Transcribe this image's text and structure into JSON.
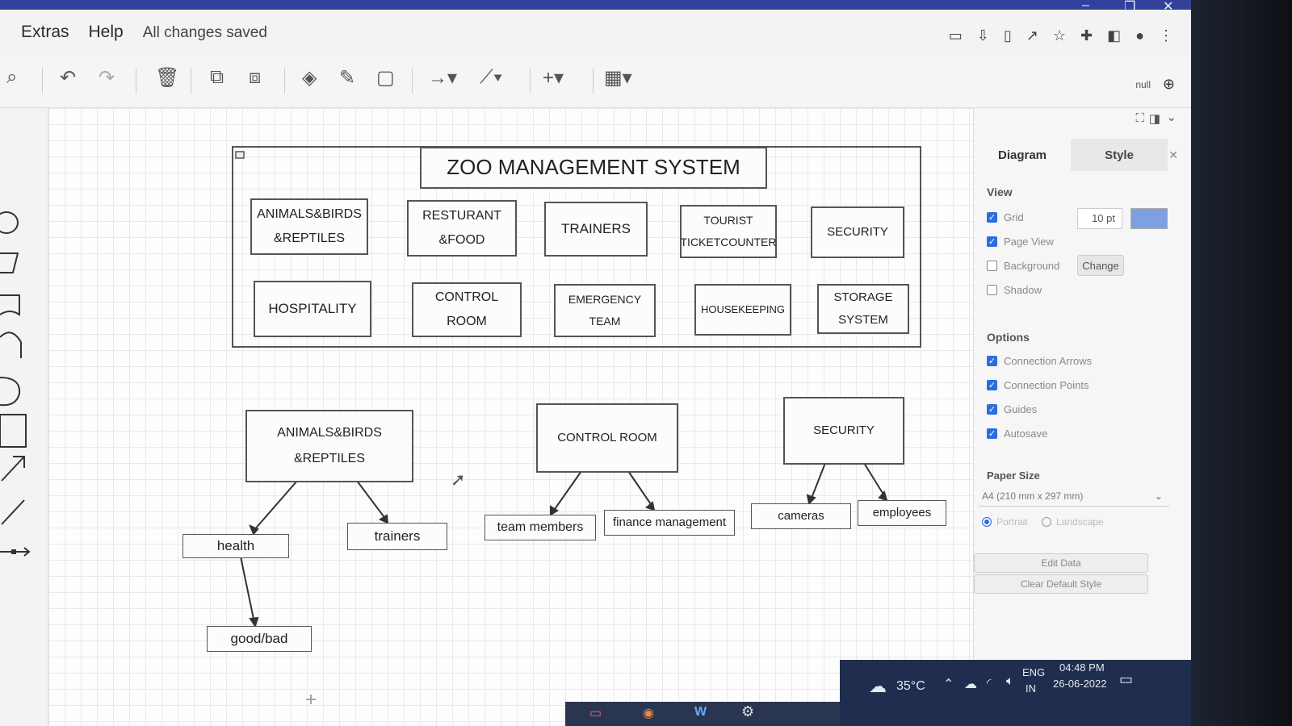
{
  "menu": {
    "extras": "Extras",
    "help": "Help",
    "status": "All changes saved"
  },
  "toolbar": {
    "zoom_value": "null"
  },
  "diagram_title": "ZOO MANAGEMENT SYSTEM",
  "modules_row1": [
    {
      "l1": "ANIMALS&BIRDS",
      "l2": "&REPTILES"
    },
    {
      "l1": "RESTURANT",
      "l2": "&FOOD"
    },
    {
      "l1": "TRAINERS",
      "l2": ""
    },
    {
      "l1": "TOURIST",
      "l2": "TICKETCOUNTER"
    },
    {
      "l1": "SECURITY",
      "l2": ""
    }
  ],
  "modules_row2": [
    {
      "l1": "HOSPITALITY",
      "l2": ""
    },
    {
      "l1": "CONTROL",
      "l2": "ROOM"
    },
    {
      "l1": "EMERGENCY",
      "l2": "TEAM"
    },
    {
      "l1": "HOUSEKEEPING",
      "l2": ""
    },
    {
      "l1": "STORAGE",
      "l2": "SYSTEM"
    }
  ],
  "tree": {
    "animals": {
      "l1": "ANIMALS&BIRDS",
      "l2": "&REPTILES"
    },
    "control_room": "CONTROL ROOM",
    "security": "SECURITY",
    "health": "health",
    "trainers": "trainers",
    "good_bad": "good/bad",
    "team_members": "team members",
    "finance": "finance management",
    "cameras": "cameras",
    "employees": "employees"
  },
  "panel": {
    "tab_diagram": "Diagram",
    "tab_style": "Style",
    "view_heading": "View",
    "grid": "Grid",
    "grid_size": "10 pt",
    "page_view": "Page View",
    "background": "Background",
    "change": "Change",
    "shadow": "Shadow",
    "options_heading": "Options",
    "connection_arrows": "Connection Arrows",
    "connection_points": "Connection Points",
    "guides": "Guides",
    "autosave": "Autosave",
    "paper_size_heading": "Paper Size",
    "paper_size": "A4 (210 mm x 297 mm)",
    "portrait": "Portrait",
    "landscape": "Landscape",
    "edit_data": "Edit Data",
    "clear_default_style": "Clear Default Style"
  },
  "taskbar": {
    "temperature": "35°C",
    "lang1": "ENG",
    "lang2": "IN",
    "time": "04:48 PM",
    "date": "26-06-2022"
  },
  "colors": {
    "accent": "#2b6de0",
    "titlebar": "#33419c",
    "taskbar": "#1f2e4e"
  }
}
